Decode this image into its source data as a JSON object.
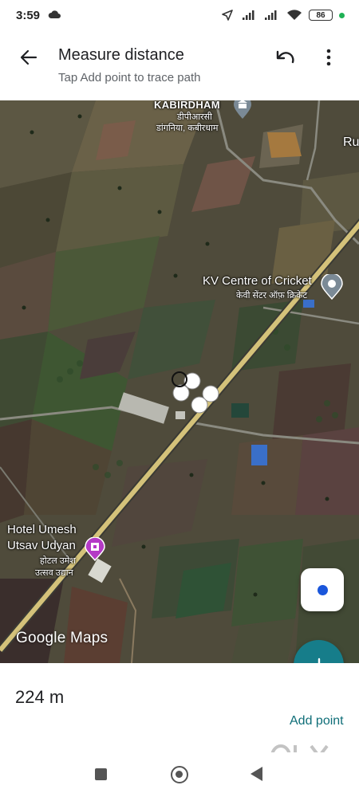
{
  "status_bar": {
    "time": "3:59",
    "battery": "86"
  },
  "app_bar": {
    "title": "Measure distance",
    "subtitle": "Tap Add point to trace path",
    "back_icon": "arrow-back-icon",
    "undo_icon": "undo-icon",
    "more_icon": "more-vert-icon"
  },
  "map": {
    "places": {
      "kabirdham": "KABIRDHAM",
      "kabirdham_hi_1": "डीपीआरसी",
      "kabirdham_hi_2": "डांगनिया, कबीरधाम",
      "partial_right": "Ru",
      "kv_cricket": "KV Centre of Cricket",
      "kv_cricket_hi": "केवी सेंटर ऑफ़ क्रिकेट",
      "hotel_line1": "Hotel Umesh",
      "hotel_line2": "Utsav Udyan",
      "hotel_hi_1": "होटल उमेश",
      "hotel_hi_2": "उत्सव उद्यान"
    },
    "attribution": "Google Maps",
    "colors": {
      "road": "#d4c27a",
      "pin_purple": "#b43ac6",
      "pin_gray": "#7b8a96"
    }
  },
  "controls": {
    "locate_icon": "my-location-icon",
    "add_icon": "plus-icon",
    "fab_color": "#167d8a"
  },
  "measurement": {
    "distance": "224 m",
    "add_point_label": "Add point"
  },
  "watermark": "OLX",
  "nav_bar": {
    "recents_icon": "square-icon",
    "home_icon": "circle-icon",
    "back_icon": "triangle-back-icon"
  }
}
